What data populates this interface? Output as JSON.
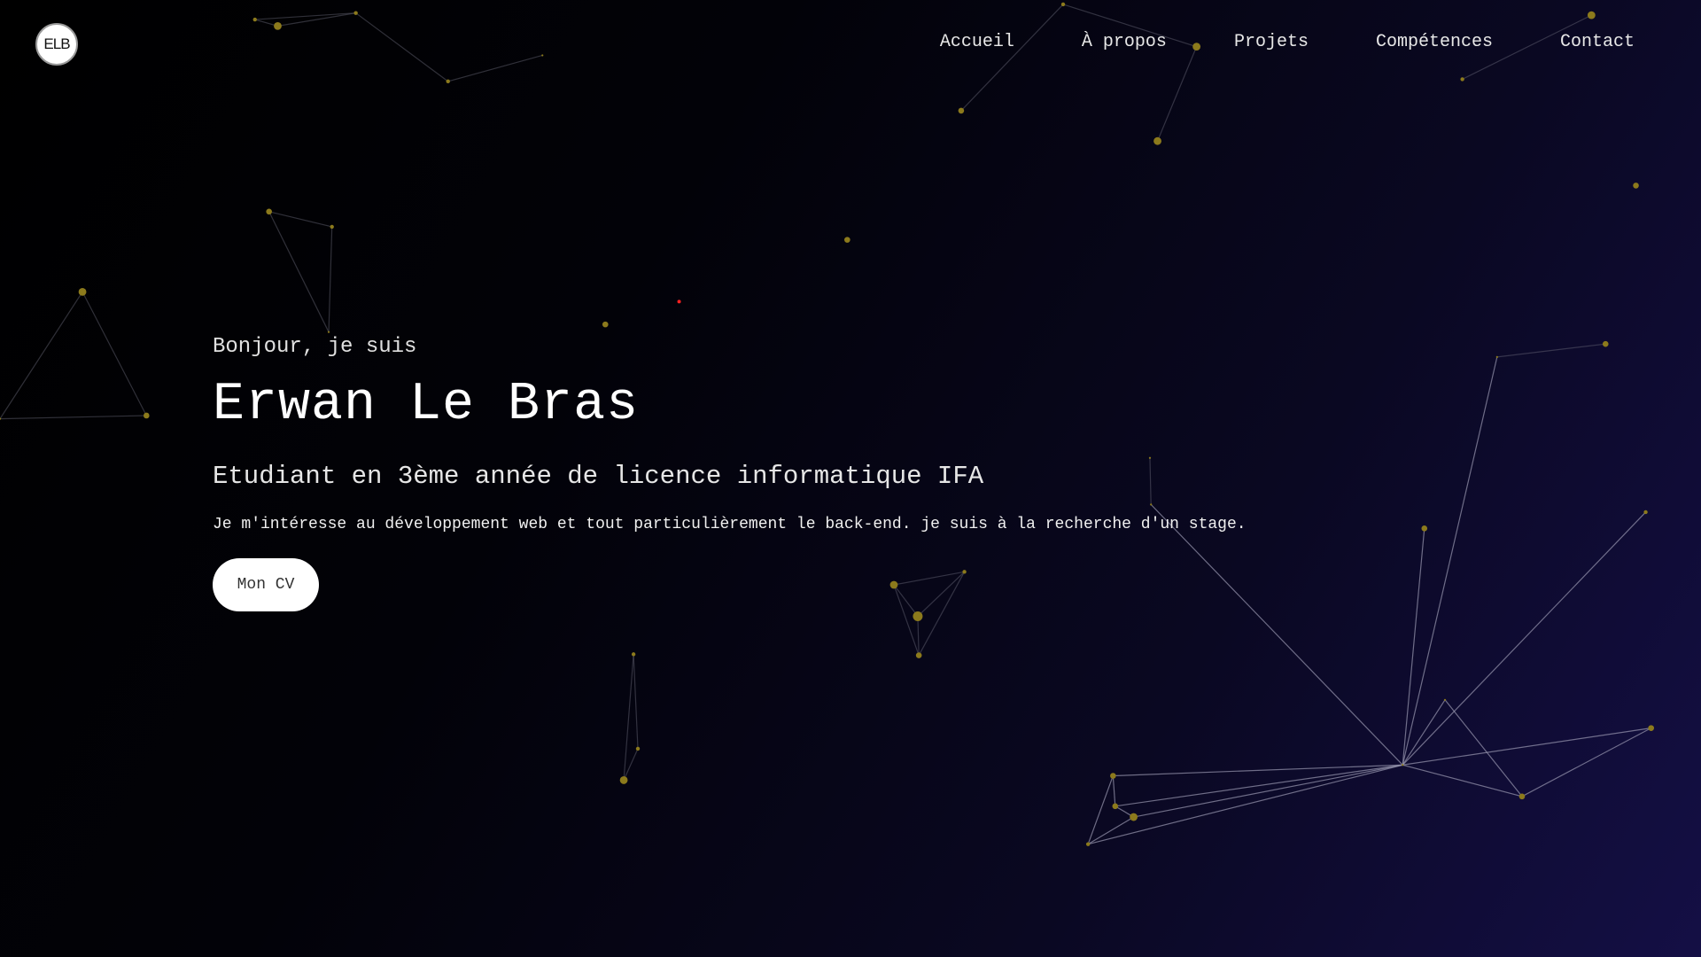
{
  "logo": {
    "text": "ELB"
  },
  "nav": {
    "items": [
      {
        "label": "Accueil"
      },
      {
        "label": "À propos"
      },
      {
        "label": "Projets"
      },
      {
        "label": "Compétences"
      },
      {
        "label": "Contact"
      }
    ]
  },
  "hero": {
    "greeting": "Bonjour, je suis",
    "name": "Erwan Le Bras",
    "subtitle": "Etudiant en 3ème année de licence informatique IFA",
    "description": "Je m'intéresse au développement web et tout particulièrement le back-end. je suis à la recherche d'un stage.",
    "cv_button": "Mon CV"
  },
  "colors": {
    "particle": "#8c7a1c",
    "line": "#6b6b7a",
    "accent_dot": "#ff2020"
  }
}
